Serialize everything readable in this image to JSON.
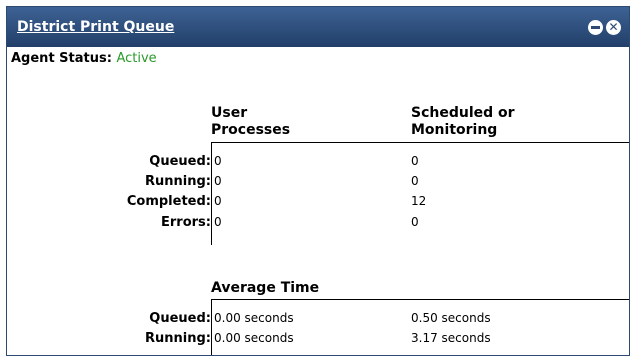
{
  "window": {
    "title": "District Print Queue",
    "minimize_icon": "minimize-icon",
    "close_icon": "close-icon"
  },
  "agent_status": {
    "label": "Agent Status:",
    "value": "Active",
    "value_color": "#2a9a2a"
  },
  "process_table": {
    "col1_header_line1": "User",
    "col1_header_line2": "Processes",
    "col2_header_line1": "Scheduled or",
    "col2_header_line2": "Monitoring",
    "rows": [
      {
        "label": "Queued:",
        "user": "0",
        "scheduled": "0"
      },
      {
        "label": "Running:",
        "user": "0",
        "scheduled": "0"
      },
      {
        "label": "Completed:",
        "user": "0",
        "scheduled": "12"
      },
      {
        "label": "Errors:",
        "user": "0",
        "scheduled": "0"
      }
    ]
  },
  "average_time": {
    "header": "Average Time",
    "rows": [
      {
        "label": "Queued:",
        "user": "0.00 seconds",
        "scheduled": "0.50 seconds"
      },
      {
        "label": "Running:",
        "user": "0.00 seconds",
        "scheduled": "3.17 seconds"
      }
    ]
  },
  "colors": {
    "titlebar": "#2c4a72",
    "active_status": "#2a9a2a"
  }
}
